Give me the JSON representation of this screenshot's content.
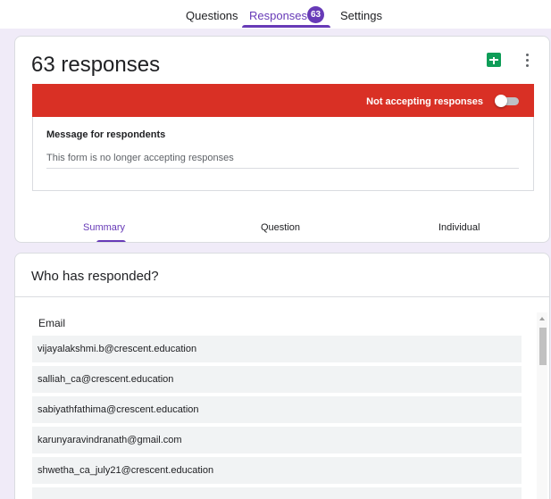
{
  "tabs": {
    "questions": "Questions",
    "responses": "Responses",
    "responses_count": "63",
    "settings": "Settings"
  },
  "summary_card": {
    "title": "63 responses",
    "status_text": "Not accepting responses",
    "accepting_toggle_on": false,
    "message_label": "Message for respondents",
    "message_value": "This form is no longer accepting responses",
    "subtabs": {
      "summary": "Summary",
      "question": "Question",
      "individual": "Individual"
    }
  },
  "respondents_card": {
    "title": "Who has responded?",
    "column_header": "Email",
    "emails": [
      "vijayalakshmi.b@crescent.education",
      "salliah_ca@crescent.education",
      "sabiyathfathima@crescent.education",
      "karunyaravindranath@gmail.com",
      "shwetha_ca_july21@crescent.education"
    ]
  },
  "colors": {
    "accent": "#673ab7",
    "banner": "#d93025",
    "background": "#f0ebf8",
    "sheets": "#0f9d58"
  },
  "icons": [
    "sheets-icon",
    "more-vert-icon",
    "toggle-switch",
    "scroll-up-arrow"
  ]
}
